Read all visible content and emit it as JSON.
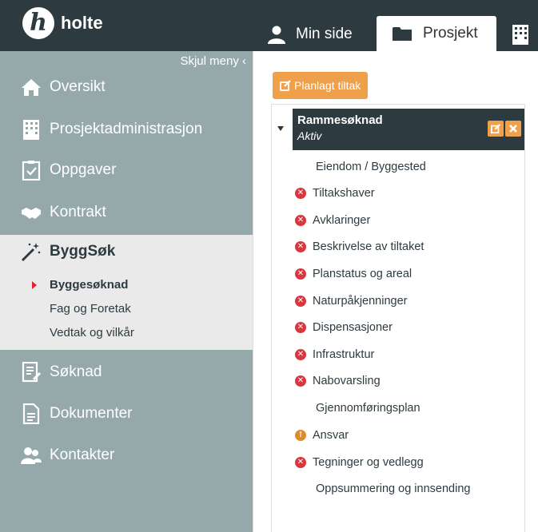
{
  "app": {
    "logo_letter": "h",
    "logo_text": "holte"
  },
  "tabs": [
    {
      "label": "Min side",
      "icon": "user-icon"
    },
    {
      "label": "Prosjekt",
      "icon": "folder-icon"
    },
    {
      "label": "",
      "icon": "building-icon"
    }
  ],
  "sidebar": {
    "hide_label": "Skjul meny",
    "hide_icon": "‹",
    "items": [
      {
        "label": "Oversikt",
        "icon": "home-icon"
      },
      {
        "label": "Prosjektadministrasjon",
        "icon": "building-icon"
      },
      {
        "label": "Oppgaver",
        "icon": "clipboard-icon"
      },
      {
        "label": "Kontrakt",
        "icon": "handshake-icon"
      }
    ],
    "active_section": {
      "label": "ByggSøk",
      "icon": "magic-wand-icon",
      "subitems": [
        {
          "label": "Byggesøknad",
          "active": true
        },
        {
          "label": "Fag og Foretak",
          "active": false
        },
        {
          "label": "Vedtak og vilkår",
          "active": false
        }
      ]
    },
    "items_after": [
      {
        "label": "Søknad",
        "icon": "form-icon"
      },
      {
        "label": "Dokumenter",
        "icon": "document-icon"
      },
      {
        "label": "Kontakter",
        "icon": "users-icon"
      }
    ]
  },
  "main": {
    "plan_button": "Planlagt tiltak",
    "application": {
      "title": "Rammesøknad",
      "status": "Aktiv",
      "edit_icon": "edit-icon",
      "delete_icon": "close-icon"
    },
    "steps": [
      {
        "label": "Eiendom / Byggested",
        "status": "none"
      },
      {
        "label": "Tiltakshaver",
        "status": "error"
      },
      {
        "label": "Avklaringer",
        "status": "error"
      },
      {
        "label": "Beskrivelse av tiltaket",
        "status": "error"
      },
      {
        "label": "Planstatus og areal",
        "status": "error"
      },
      {
        "label": "Naturpåkjenninger",
        "status": "error"
      },
      {
        "label": "Dispensasjoner",
        "status": "error"
      },
      {
        "label": "Infrastruktur",
        "status": "error"
      },
      {
        "label": "Nabovarsling",
        "status": "error"
      },
      {
        "label": "Gjennomføringsplan",
        "status": "none"
      },
      {
        "label": "Ansvar",
        "status": "warning"
      },
      {
        "label": "Tegninger og vedlegg",
        "status": "error"
      },
      {
        "label": "Oppsummering og innsending",
        "status": "none"
      }
    ]
  },
  "colors": {
    "header": "#2d3b40",
    "sidebar": "#95a9ab",
    "accent": "#f0a04b",
    "error": "#d9363e",
    "warning": "#e08a2b"
  }
}
